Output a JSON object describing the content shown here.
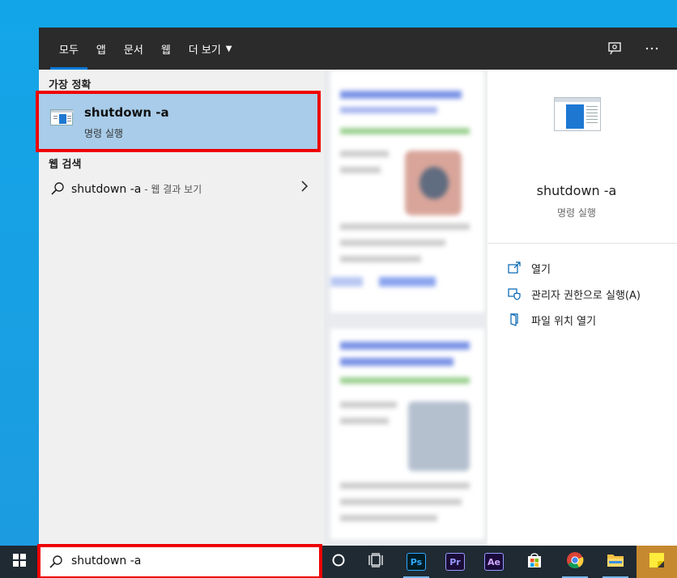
{
  "tabs": [
    {
      "label": "모두"
    },
    {
      "label": "앱"
    },
    {
      "label": "문서"
    },
    {
      "label": "웹"
    },
    {
      "label": "더 보기"
    }
  ],
  "top_icons": [
    "feedback-icon",
    "more-options-icon"
  ],
  "results": {
    "best_match_header": "가장 정확",
    "best_match": {
      "title": "shutdown -a",
      "subtitle": "명령 실행",
      "icon": "run-command-icon"
    },
    "web_header": "웹 검색",
    "web_search": {
      "query": "shutdown -a",
      "suffix": " - 웹 결과 보기"
    }
  },
  "details": {
    "title": "shutdown -a",
    "subtitle": "명령 실행",
    "actions": [
      {
        "label": "열기",
        "icon": "open-icon"
      },
      {
        "label": "관리자 권한으로 실행(A)",
        "icon": "shield-icon"
      },
      {
        "label": "파일 위치 열기",
        "icon": "file-location-icon"
      }
    ]
  },
  "taskbar": {
    "search_value": "shutdown -a",
    "apps": [
      {
        "name": "cortana",
        "label": ""
      },
      {
        "name": "task-view",
        "label": ""
      },
      {
        "name": "photoshop",
        "label": "Ps"
      },
      {
        "name": "premiere",
        "label": "Pr"
      },
      {
        "name": "after-effects",
        "label": "Ae"
      },
      {
        "name": "store",
        "label": ""
      },
      {
        "name": "chrome",
        "label": ""
      },
      {
        "name": "file-explorer",
        "label": ""
      },
      {
        "name": "sticky-notes",
        "label": ""
      }
    ]
  },
  "colors": {
    "accent": "#0078d7",
    "highlight": "#a8cce9",
    "annotation": "#e00000",
    "topbar": "#2b2b2b",
    "taskbar": "#1f2a33"
  }
}
